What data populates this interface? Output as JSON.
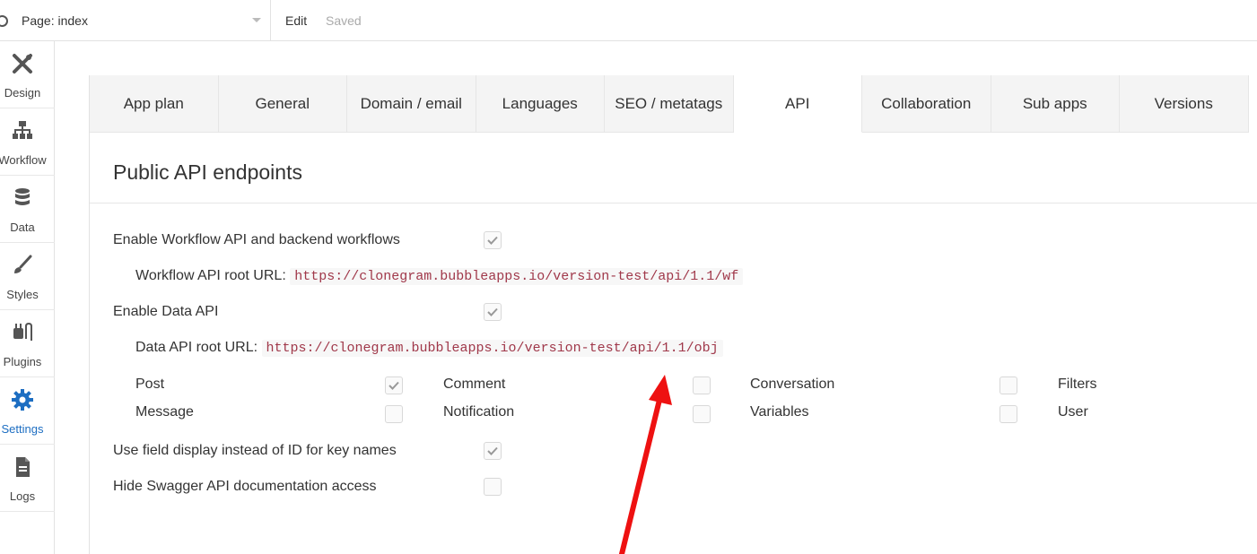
{
  "topbar": {
    "page_label": "Page: index",
    "edit_label": "Edit",
    "saved_label": "Saved"
  },
  "sidebar": {
    "items": [
      {
        "label": "Design",
        "icon": "design-icon"
      },
      {
        "label": "Workflow",
        "icon": "workflow-icon"
      },
      {
        "label": "Data",
        "icon": "database-icon"
      },
      {
        "label": "Styles",
        "icon": "brush-icon"
      },
      {
        "label": "Plugins",
        "icon": "plug-icon"
      },
      {
        "label": "Settings",
        "icon": "gear-icon"
      },
      {
        "label": "Logs",
        "icon": "document-icon"
      }
    ],
    "active": "Settings"
  },
  "tabs": {
    "items": [
      {
        "label": "App plan"
      },
      {
        "label": "General"
      },
      {
        "label": "Domain / email"
      },
      {
        "label": "Languages"
      },
      {
        "label": "SEO / metatags"
      },
      {
        "label": "API"
      },
      {
        "label": "Collaboration"
      },
      {
        "label": "Sub apps"
      },
      {
        "label": "Versions"
      }
    ],
    "active": "API"
  },
  "api": {
    "section_title": "Public API endpoints",
    "enable_workflow_label": "Enable Workflow API and backend workflows",
    "enable_workflow_checked": true,
    "workflow_root_label": "Workflow API root URL:",
    "workflow_root_url": "https://clonegram.bubbleapps.io/version-test/api/1.1/wf",
    "enable_data_label": "Enable Data API",
    "enable_data_checked": true,
    "data_root_label": "Data API root URL:",
    "data_root_url": "https://clonegram.bubbleapps.io/version-test/api/1.1/obj",
    "data_types": [
      {
        "label": "Post",
        "checked": true
      },
      {
        "label": "Comment",
        "checked": false
      },
      {
        "label": "Conversation",
        "checked": false
      },
      {
        "label": "Filters",
        "checked": false
      },
      {
        "label": "Message",
        "checked": false
      },
      {
        "label": "Notification",
        "checked": false
      },
      {
        "label": "Variables",
        "checked": false
      },
      {
        "label": "User",
        "checked": false
      }
    ],
    "field_display_label": "Use field display instead of ID for key names",
    "field_display_checked": true,
    "hide_swagger_label": "Hide Swagger API documentation access",
    "hide_swagger_checked": false
  },
  "colors": {
    "accent": "#1d6ec2",
    "url_text": "#a0384a",
    "annotation_arrow": "#ee1111"
  }
}
